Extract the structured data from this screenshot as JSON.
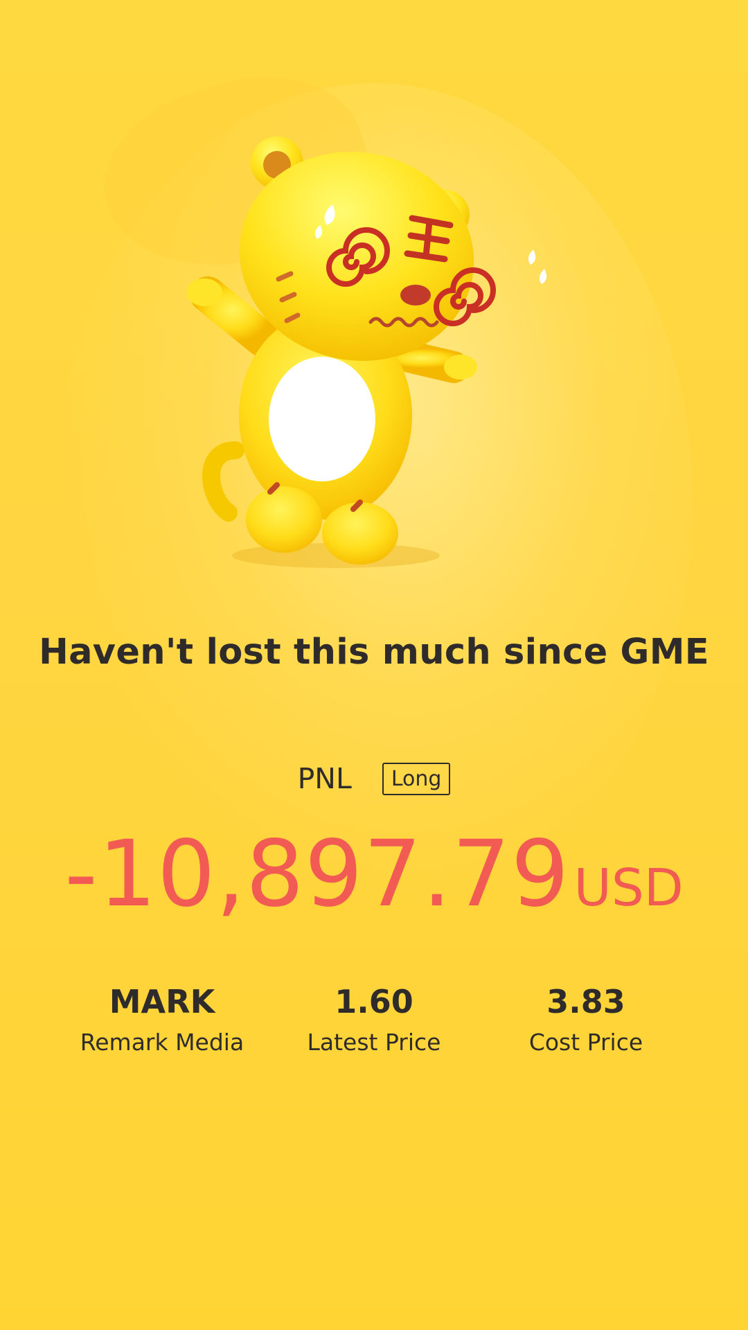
{
  "headline": "Haven't lost this much since GME",
  "pnl": {
    "label": "PNL",
    "direction": "Long",
    "value": "-10,897.79",
    "unit": "USD",
    "value_color": "#f25a54"
  },
  "stats": [
    {
      "value": "MARK",
      "label": "Remark Media"
    },
    {
      "value": "1.60",
      "label": "Latest Price"
    },
    {
      "value": "3.83",
      "label": "Cost Price"
    }
  ],
  "mascot": {
    "icon": "dizzy-tiger-mascot-icon"
  },
  "colors": {
    "background": "#ffd93f",
    "text": "#2e2b2a",
    "loss": "#f25a54"
  }
}
